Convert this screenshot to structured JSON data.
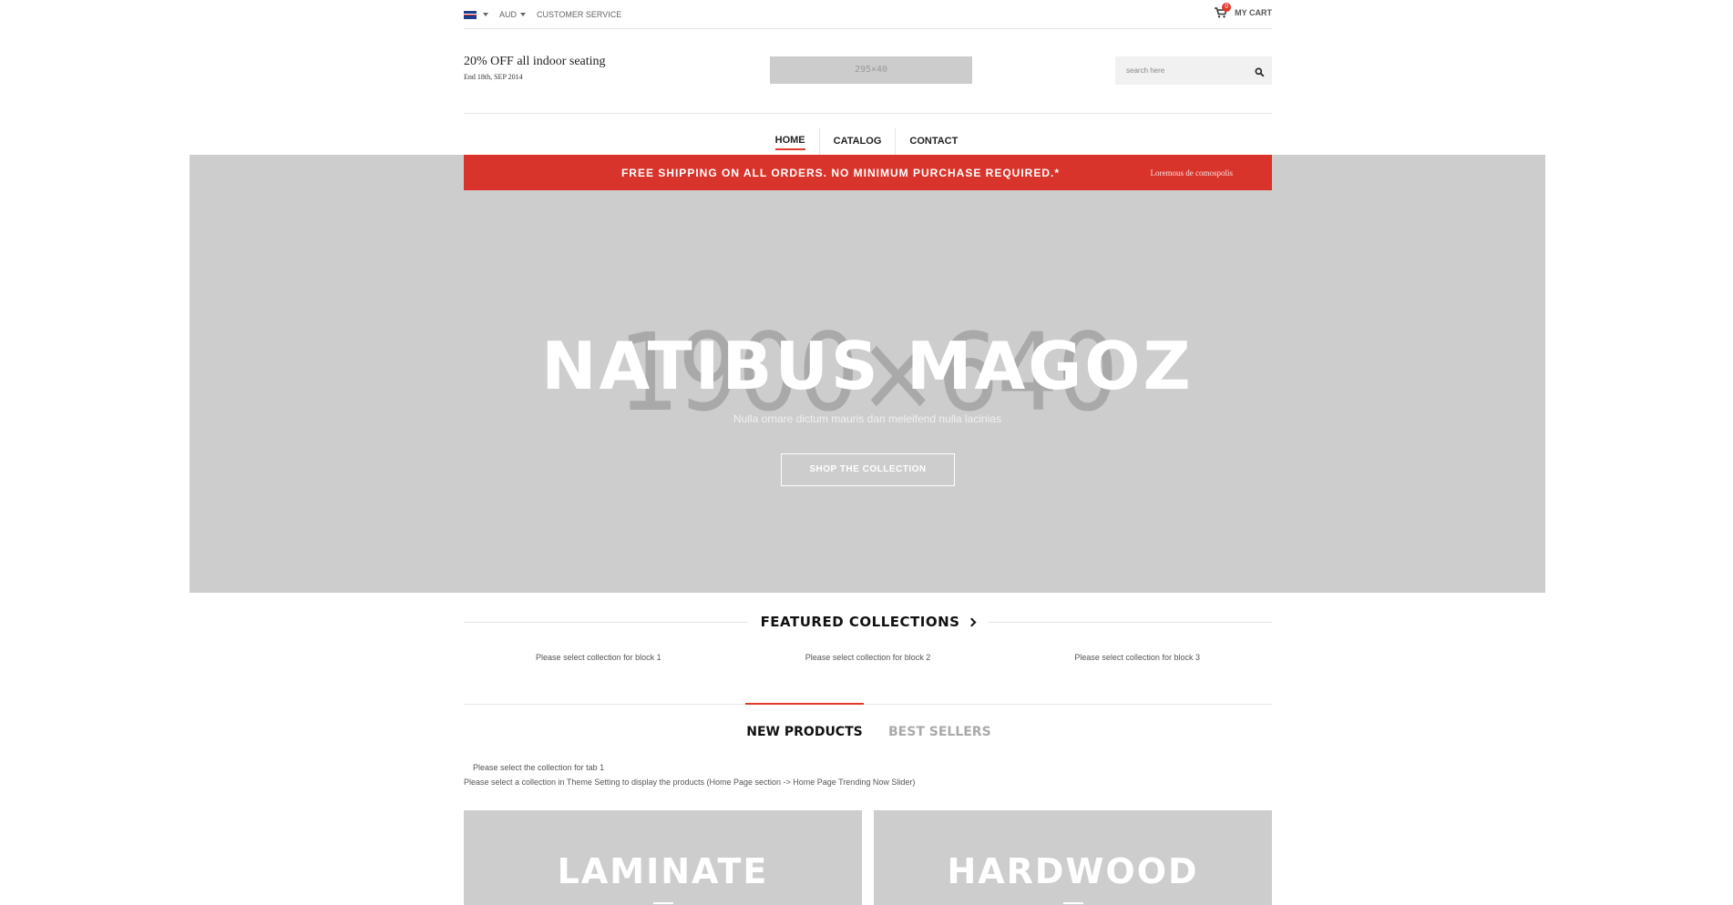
{
  "topbar": {
    "language_flag": "uk-flag-icon",
    "currency": "AUD",
    "customer_service": "CUSTOMER SERVICE",
    "cart_count": "0",
    "cart_label": "MY CART"
  },
  "header": {
    "promo_title": "20% OFF all indoor seating",
    "promo_date": "End 18th, SEP 2014",
    "logo_placeholder": "295×40",
    "search_placeholder": "search here"
  },
  "nav": {
    "items": [
      {
        "label": "HOME",
        "active": true
      },
      {
        "label": "CATALOG",
        "active": false
      },
      {
        "label": "CONTACT",
        "active": false
      }
    ]
  },
  "shipping_bar": {
    "text": "FREE SHIPPING ON ALL ORDERS. NO MINIMUM PURCHASE REQUIRED.*",
    "link": "Loremous de comospolis"
  },
  "hero": {
    "placeholder": "1900×640",
    "title": "NATIBUS MAGOZ",
    "subtitle": "Nulla ornare dictum mauris dan meleifend nulla lacinias",
    "button": "SHOP THE COLLECTION"
  },
  "featured": {
    "title": "FEATURED COLLECTIONS",
    "blocks": [
      "Please select collection for block 1",
      "Please select collection for block 2",
      "Please select collection for block 3"
    ]
  },
  "tabs": {
    "items": [
      "NEW PRODUCTS",
      "BEST SELLERS"
    ],
    "message1": "Please select the collection for tab 1",
    "message2": "Please select a collection in Theme Setting to display the products (Home Page section -> Home Page Trending Now Slider)"
  },
  "tiles": [
    "LAMINATE",
    "HARDWOOD"
  ],
  "colors": {
    "accent": "#e03a2c",
    "placeholder_gray": "#cdcdcd"
  }
}
